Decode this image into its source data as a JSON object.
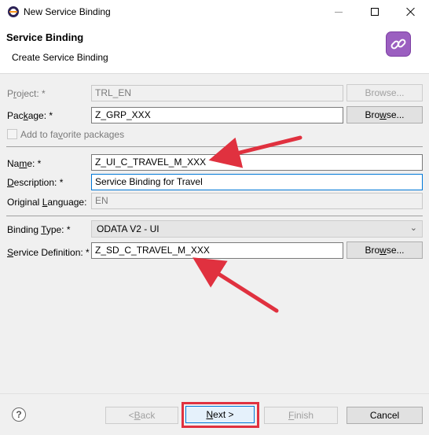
{
  "window": {
    "title": "New Service Binding"
  },
  "header": {
    "title": "Service Binding",
    "subtitle": "Create Service Binding"
  },
  "form": {
    "project": {
      "label_prefix": "P",
      "label_ul": "r",
      "label_rest": "oject: *",
      "value": "TRL_EN",
      "browse": "Browse..."
    },
    "package": {
      "label_prefix": "Pac",
      "label_ul": "k",
      "label_rest": "age: *",
      "value": "Z_GRP_XXX",
      "browse_prefix": "Bro",
      "browse_ul": "w",
      "browse_rest": "se..."
    },
    "favorite": {
      "label_prefix": "Add to fa",
      "label_ul": "v",
      "label_rest": "orite packages"
    },
    "name": {
      "label_prefix": "Na",
      "label_ul": "m",
      "label_rest": "e: *",
      "value": "Z_UI_C_TRAVEL_M_XXX"
    },
    "description": {
      "label_ul": "D",
      "label_rest": "escription: *",
      "value": "Service Binding for Travel"
    },
    "language": {
      "label_prefix": "Original ",
      "label_ul": "L",
      "label_rest": "anguage:",
      "value": "EN"
    },
    "binding_type": {
      "label_prefix": "Binding ",
      "label_ul": "T",
      "label_rest": "ype: *",
      "value": "ODATA V2 - UI"
    },
    "service_definition": {
      "label_ul": "S",
      "label_rest": "ervice Definition: *",
      "value": "Z_SD_C_TRAVEL_M_XXX",
      "browse_prefix": "Bro",
      "browse_ul": "w",
      "browse_rest": "se..."
    }
  },
  "footer": {
    "help": "?",
    "back_prefix": "< ",
    "back_ul": "B",
    "back_rest": "ack",
    "next_ul": "N",
    "next_rest": "ext >",
    "finish_ul": "F",
    "finish_rest": "inish",
    "cancel": "Cancel"
  },
  "colors": {
    "accent": "#0078d7",
    "annotation": "#e0313f",
    "wizard_icon": "#9b5fc0"
  }
}
